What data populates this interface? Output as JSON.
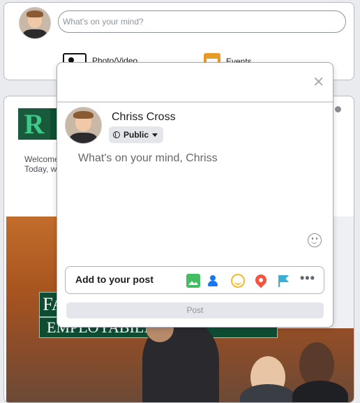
{
  "composer_card": {
    "placeholder": "What's on your mind?",
    "actions": [
      {
        "label": "Photo/Video",
        "icon": "photo-icon"
      },
      {
        "label": "Events",
        "icon": "calendar-icon"
      }
    ]
  },
  "post_card": {
    "logo_letter": "R",
    "welcome_text_line1": "Welcome",
    "welcome_text_line2": "Today, w",
    "banner_fragment_1": "FA",
    "banner_fragment_2": "EMPLOYABILITY DAY"
  },
  "modal": {
    "user_name": "Chriss Cross",
    "privacy_label": "Public",
    "composer_placeholder": "What's on your mind, Chriss",
    "add_to_post_label": "Add to your post",
    "tools": [
      "photo-icon",
      "tag-people-icon",
      "feeling-icon",
      "location-icon",
      "flag-icon",
      "more-icon"
    ],
    "more_glyph": "•••",
    "post_button_label": "Post",
    "close_glyph": "✕"
  },
  "colors": {
    "photo_green": "#45bd62",
    "tag_blue": "#1877f2",
    "feeling_yellow": "#f7b928",
    "location_red": "#f5533d",
    "flag_teal": "#39afd5",
    "brand_green": "#0f4d33"
  }
}
